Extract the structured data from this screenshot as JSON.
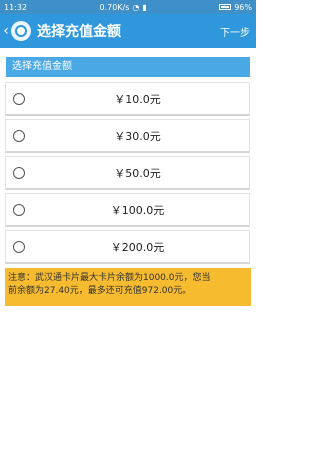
{
  "status_bar": {
    "time": "11:32",
    "speed": "0.70K/s",
    "battery": "96%"
  },
  "app_bar": {
    "title": "选择充值金额",
    "next_label": "下一步"
  },
  "section": {
    "heading": "选择充值金额"
  },
  "options": [
    {
      "label": "￥10.0元"
    },
    {
      "label": "￥30.0元"
    },
    {
      "label": "￥50.0元"
    },
    {
      "label": "￥100.0元"
    },
    {
      "label": "￥200.0元"
    }
  ],
  "notice": {
    "line1": "注意：武汉通卡片最大卡片余额为1000.0元，您当",
    "line2": "前余额为27.40元，最多还可充值972.00元。"
  },
  "colors": {
    "app_bar": "#2f97dc",
    "section_head": "#4aa9e5",
    "notice_bg": "#f6bb2f"
  }
}
